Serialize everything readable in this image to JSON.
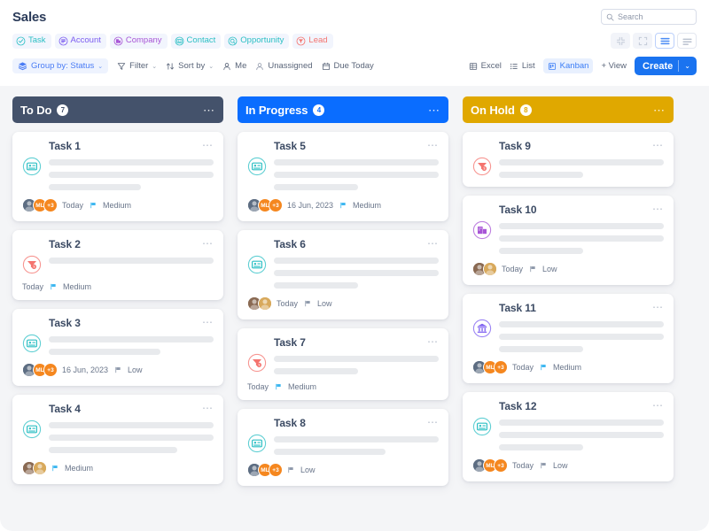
{
  "header": {
    "title": "Sales",
    "search": {
      "placeholder": "Search",
      "icon": "search-icon"
    }
  },
  "entity_chips": [
    {
      "label": "Task",
      "icon": "task-icon",
      "color": "#2bbfc4"
    },
    {
      "label": "Account",
      "icon": "account-icon",
      "color": "#7b5cf0"
    },
    {
      "label": "Company",
      "icon": "company-icon",
      "color": "#a855d6"
    },
    {
      "label": "Contact",
      "icon": "contact-icon",
      "color": "#2bbfc4"
    },
    {
      "label": "Opportunity",
      "icon": "opportunity-icon",
      "color": "#2bbfc4"
    },
    {
      "label": "Lead",
      "icon": "lead-icon",
      "color": "#f4736e"
    }
  ],
  "view_toggles": [
    {
      "name": "collapse-view-icon",
      "active": false,
      "style": "plain"
    },
    {
      "name": "expand-view-icon",
      "active": false,
      "style": "plain"
    },
    {
      "name": "comfortable-rows-icon",
      "active": true,
      "style": "active"
    },
    {
      "name": "compact-rows-icon",
      "active": false,
      "style": "bordered"
    }
  ],
  "toolbar": {
    "group_by": {
      "label": "Group by: Status",
      "icon": "layers-icon",
      "caret": "⌄"
    },
    "filter": {
      "label": "Filter",
      "icon": "funnel-icon",
      "caret": "⌄"
    },
    "sort_by": {
      "label": "Sort by",
      "icon": "sort-arrows-icon",
      "caret": "⌄"
    },
    "me": {
      "label": "Me",
      "icon": "person-icon"
    },
    "unassigned": {
      "label": "Unassigned",
      "icon": "person-outline-icon"
    },
    "due_today": {
      "label": "Due Today",
      "icon": "calendar-icon"
    },
    "excel": {
      "label": "Excel",
      "icon": "grid-icon"
    },
    "list": {
      "label": "List",
      "icon": "list-icon"
    },
    "kanban": {
      "label": "Kanban",
      "icon": "kanban-icon",
      "active": true
    },
    "add_view": {
      "label": "+ View"
    },
    "create": {
      "label": "Create",
      "caret": "⌄"
    }
  },
  "board": {
    "columns": [
      {
        "title": "To Do",
        "count": "7",
        "color": "#44526b",
        "menu_icon": "more-horizontal-icon",
        "cards": [
          {
            "title": "Task 1",
            "icon": "contact-icon",
            "icon_color": "#2bbfc4",
            "lines": [
              100,
              100,
              56
            ],
            "avatars": [
              {
                "type": "photo",
                "tone": "#5d6d82"
              },
              {
                "type": "initials",
                "label": "ML"
              },
              {
                "type": "count",
                "label": "+3"
              }
            ],
            "date": "Today",
            "priority": "Medium",
            "flag_color": "#3ab6f0"
          },
          {
            "title": "Task 2",
            "icon": "lead-icon",
            "icon_color": "#f4736e",
            "lines": [
              100
            ],
            "avatars": [],
            "date": "Today",
            "priority": "Medium",
            "flag_color": "#3ab6f0"
          },
          {
            "title": "Task 3",
            "icon": "contact-icon",
            "icon_color": "#2bbfc4",
            "lines": [
              100,
              68
            ],
            "avatars": [
              {
                "type": "photo",
                "tone": "#5d6d82"
              },
              {
                "type": "initials",
                "label": "ML"
              },
              {
                "type": "count",
                "label": "+3"
              }
            ],
            "date": "16 Jun, 2023",
            "priority": "Low",
            "flag_color": "#8e99ab"
          },
          {
            "title": "Task 4",
            "icon": "contact-icon",
            "icon_color": "#2bbfc4",
            "lines": [
              100,
              100,
              78
            ],
            "avatars": [
              {
                "type": "photo",
                "tone": "#8a6a53"
              },
              {
                "type": "photo",
                "tone": "#d8a95c"
              }
            ],
            "date": "",
            "priority": "Medium",
            "flag_color": "#3ab6f0"
          }
        ]
      },
      {
        "title": "In Progress",
        "count": "4",
        "color": "#0a6dff",
        "menu_icon": "more-horizontal-icon",
        "cards": [
          {
            "title": "Task 5",
            "icon": "contact-icon",
            "icon_color": "#2bbfc4",
            "lines": [
              100,
              100,
              51
            ],
            "avatars": [
              {
                "type": "photo",
                "tone": "#5d6d82"
              },
              {
                "type": "initials",
                "label": "ML"
              },
              {
                "type": "count",
                "label": "+3"
              }
            ],
            "date": "16 Jun, 2023",
            "priority": "Medium",
            "flag_color": "#3ab6f0"
          },
          {
            "title": "Task 6",
            "icon": "contact-icon",
            "icon_color": "#2bbfc4",
            "lines": [
              100,
              100,
              51
            ],
            "avatars": [
              {
                "type": "photo",
                "tone": "#8a6a53"
              },
              {
                "type": "photo",
                "tone": "#d8a95c"
              }
            ],
            "date": "Today",
            "priority": "Low",
            "flag_color": "#8e99ab"
          },
          {
            "title": "Task 7",
            "icon": "lead-icon",
            "icon_color": "#f4736e",
            "lines": [
              100,
              51
            ],
            "avatars": [],
            "date": "Today",
            "priority": "Medium",
            "flag_color": "#3ab6f0"
          },
          {
            "title": "Task  8",
            "icon": "contact-icon",
            "icon_color": "#2bbfc4",
            "lines": [
              100,
              68
            ],
            "avatars": [
              {
                "type": "photo",
                "tone": "#5d6d82"
              },
              {
                "type": "initials",
                "label": "ML"
              },
              {
                "type": "count",
                "label": "+3"
              }
            ],
            "date": "",
            "priority": "Low",
            "flag_color": "#8e99ab"
          }
        ]
      },
      {
        "title": "On Hold",
        "count": "8",
        "color": "#e0a800",
        "menu_icon": "more-horizontal-icon",
        "cards": [
          {
            "title": "Task 9",
            "icon": "lead-icon",
            "icon_color": "#f4736e",
            "lines": [
              100,
              51
            ],
            "avatars": [],
            "date": "",
            "priority": "",
            "flag_color": ""
          },
          {
            "title": "Task 10",
            "icon": "company-icon",
            "icon_color": "#a855d6",
            "lines": [
              100,
              100,
              51
            ],
            "avatars": [
              {
                "type": "photo",
                "tone": "#8a6a53"
              },
              {
                "type": "photo",
                "tone": "#d8a95c"
              }
            ],
            "date": "Today",
            "priority": "Low",
            "flag_color": "#8e99ab"
          },
          {
            "title": "Task 11",
            "icon": "account-icon",
            "icon_color": "#7b5cf0",
            "lines": [
              100,
              100,
              51
            ],
            "avatars": [
              {
                "type": "photo",
                "tone": "#5d6d82"
              },
              {
                "type": "initials",
                "label": "ML"
              },
              {
                "type": "count",
                "label": "+3"
              }
            ],
            "date": "Today",
            "priority": "Medium",
            "flag_color": "#3ab6f0"
          },
          {
            "title": "Task 12",
            "icon": "contact-icon",
            "icon_color": "#2bbfc4",
            "lines": [
              100,
              100,
              51
            ],
            "avatars": [
              {
                "type": "photo",
                "tone": "#5d6d82"
              },
              {
                "type": "initials",
                "label": "ML"
              },
              {
                "type": "count",
                "label": "+3"
              }
            ],
            "date": "Today",
            "priority": "Low",
            "flag_color": "#8e99ab"
          }
        ]
      }
    ]
  }
}
